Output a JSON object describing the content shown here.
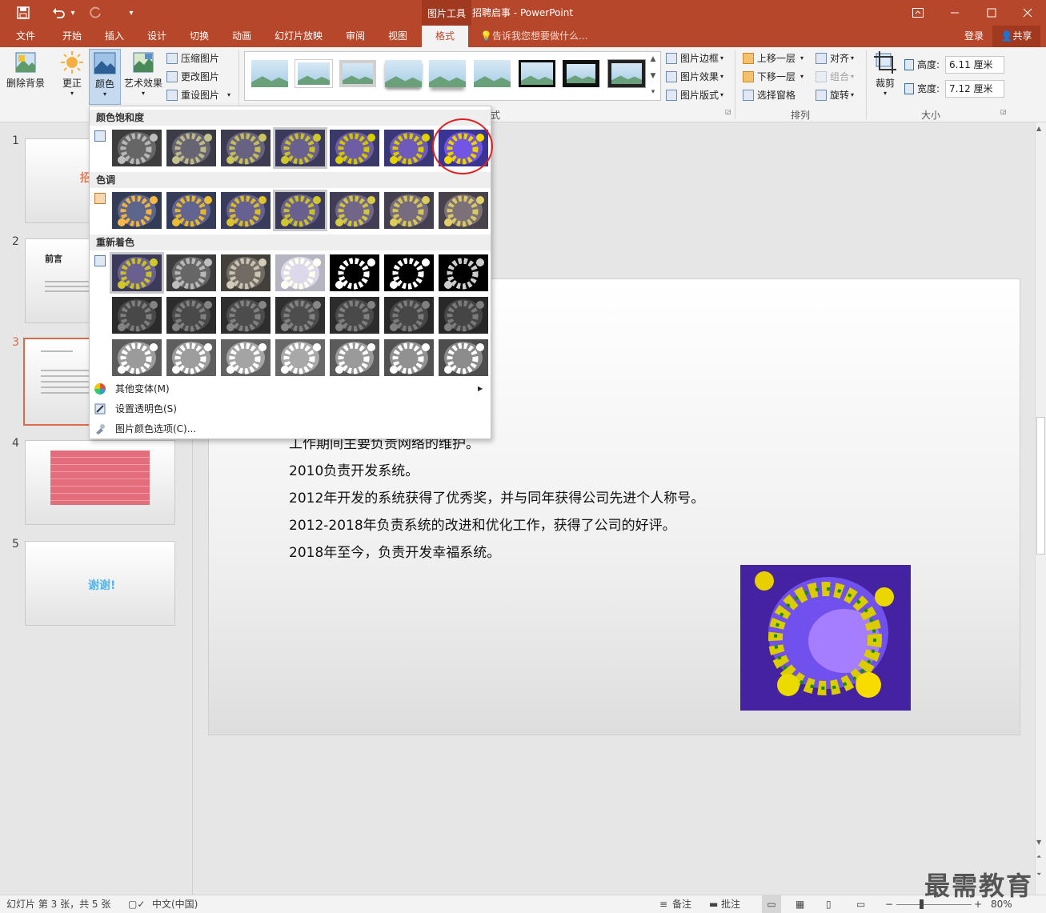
{
  "titlebar": {
    "context_tool": "图片工具",
    "title": "招聘启事 - PowerPoint",
    "save_icon": "save-icon",
    "undo_icon": "undo-icon",
    "undo_arrow": "▾",
    "redo_icon": "redo-icon",
    "customize_icon": "▾"
  },
  "tabs": [
    "文件",
    "开始",
    "插入",
    "设计",
    "切换",
    "动画",
    "幻灯片放映",
    "审阅",
    "视图",
    "格式"
  ],
  "tell_me": "告诉我您想要做什么...",
  "login": "登录",
  "share": "共享",
  "ribbon": {
    "remove_bg": "删除背景",
    "corrections": "更正",
    "color": "颜色",
    "art_effects": "艺术效果",
    "compress": "压缩图片",
    "change_pic": "更改图片",
    "reset_pic": "重设图片",
    "pic_border": "图片边框",
    "pic_effects": "图片效果",
    "pic_layout": "图片版式",
    "style_group_tail": "式",
    "bring_forward": "上移一层",
    "send_backward": "下移一层",
    "selection_pane": "选择窗格",
    "align": "对齐",
    "group": "组合",
    "rotate": "旋转",
    "arrange_label": "排列",
    "crop": "裁剪",
    "height_label": "高度:",
    "height_value": "6.11 厘米",
    "width_label": "宽度:",
    "width_value": "7.12 厘米",
    "size_label": "大小"
  },
  "dropdown": {
    "saturation_label": "颜色饱和度",
    "tone_label": "色调",
    "recolor_label": "重新着色",
    "more_variations": "其他变体(M)",
    "set_transparent": "设置透明色(S)",
    "color_options": "图片颜色选项(C)...",
    "saturation_filters": [
      "grayscale(1)",
      "saturate(0.33)",
      "saturate(0.66)",
      "saturate(1)",
      "saturate(1.5)",
      "saturate(2)",
      "saturate(3)"
    ],
    "tone_filters": [
      "hue-rotate(-20deg) saturate(0.9)",
      "hue-rotate(-12deg)",
      "hue-rotate(-6deg)",
      "saturate(1)",
      "sepia(0.2)",
      "sepia(0.35)",
      "sepia(0.5)"
    ],
    "recolor_row1": [
      "none",
      "grayscale(1)",
      "grayscale(1) sepia(0.3)",
      "grayscale(0.6) brightness(1.8) opacity(0.5)",
      "grayscale(1) contrast(8) brightness(1.4)",
      "grayscale(1) contrast(8) brightness(1.1)",
      "grayscale(1) contrast(8) brightness(0.8)"
    ],
    "recolor_row2_colors": [
      "#2a2a2a",
      "#1f4a8a",
      "#1b6670",
      "#1e6a46",
      "#6a5a1a",
      "#6a3526",
      "#6a2436"
    ],
    "recolor_row3_colors": [
      "#c8c8c8",
      "#4c7ed8",
      "#3aa6cf",
      "#3fae7a",
      "#e0a030",
      "#e07060",
      "#e05070"
    ]
  },
  "slides": [
    {
      "num": "1",
      "label": "招"
    },
    {
      "num": "2",
      "label": "前言"
    },
    {
      "num": "3",
      "label": ""
    },
    {
      "num": "4",
      "label": ""
    },
    {
      "num": "5",
      "label": "谢谢!"
    }
  ],
  "slide_body": [
    "工作期间主要负责网络的维护。",
    "2010负责开发系统。",
    "2012年开发的系统获得了优秀奖，并与同年获得公司先进个人称号。",
    "2012-2018年负责系统的改进和优化工作，获得了公司的好评。",
    "2018年至今，负责开发幸福系统。"
  ],
  "statusbar": {
    "slide_info": "幻灯片 第 3 张，共 5 张",
    "language": "中文(中国)",
    "notes": "备注",
    "comments": "批注",
    "zoom": "80%"
  },
  "watermark": "最需教育",
  "colors": {
    "accent": "#b7472a",
    "accent_dark": "#a0391f",
    "ribbon_bg": "#f3f3f3",
    "highlight": "#e02020"
  }
}
